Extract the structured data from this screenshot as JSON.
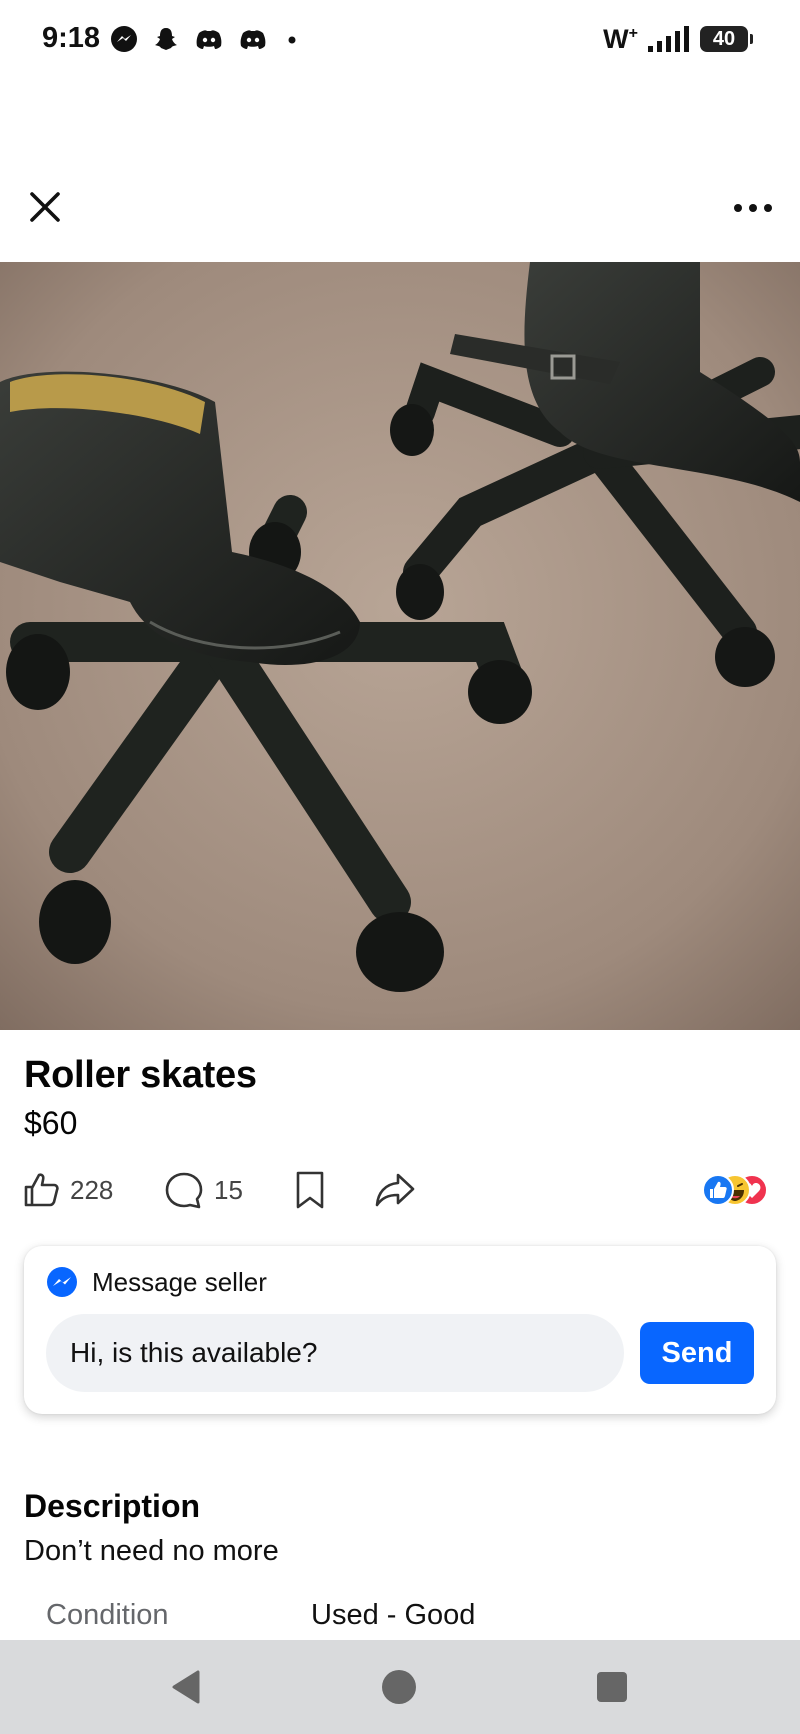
{
  "status_bar": {
    "time": "9:18",
    "network": "W",
    "network_sup": "+",
    "battery": "40",
    "icons": [
      "messenger-icon",
      "snapchat-icon",
      "discord-icon",
      "discord-icon",
      "dot-icon",
      "signal-icon",
      "battery-icon"
    ]
  },
  "header": {
    "close_icon": "close-icon",
    "more_icon": "more-options-icon"
  },
  "listing": {
    "title": "Roller skates",
    "price": "$60"
  },
  "actions": {
    "like_count": "228",
    "comment_count": "15",
    "icons": [
      "like-icon",
      "comment-icon",
      "bookmark-icon",
      "share-icon"
    ],
    "reactions": [
      "like-reaction",
      "haha-reaction",
      "love-reaction"
    ]
  },
  "message": {
    "label": "Message seller",
    "input_value": "Hi, is this available?",
    "send_label": "Send"
  },
  "description": {
    "heading": "Description",
    "text": "Don’t need no more",
    "condition_label": "Condition",
    "condition_value": "Used - Good"
  },
  "colors": {
    "accent": "#0866ff",
    "input_bg": "#f0f2f5",
    "nav_bg": "#d9dadc",
    "secondary_text": "#65676b"
  }
}
